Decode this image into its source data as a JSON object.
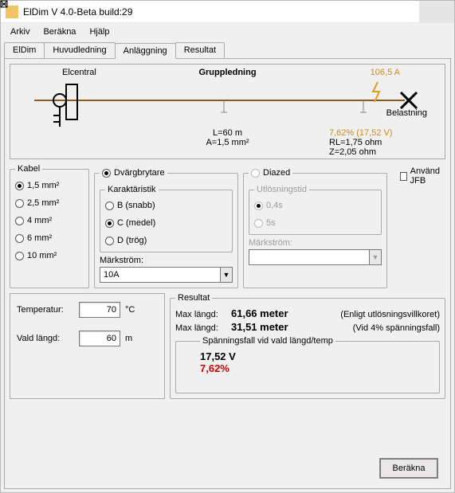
{
  "title": "ElDim V 4.0-Beta build:29",
  "menu": {
    "arkiv": "Arkiv",
    "berakna": "Beräkna",
    "hjalp": "Hjälp"
  },
  "tabs": {
    "eldim": "ElDim",
    "huvud": "Huvudledning",
    "anlagg": "Anläggning",
    "resultat": "Resultat"
  },
  "diagram": {
    "elcentral": "Elcentral",
    "gruppledning": "Gruppledning",
    "current": "106,5 A",
    "belastning": "Belastning",
    "len": "L=60 m",
    "area": "A=1,5 mm²",
    "pct": "7,62% (17,52 V)",
    "rl": "RL=1,75 ohm",
    "z": "Z=2,05 ohm"
  },
  "kabel": {
    "legend": "Kabel",
    "o1": "1,5 mm²",
    "o2": "2,5 mm²",
    "o3": "4 mm²",
    "o4": "6 mm²",
    "o5": "10 mm²"
  },
  "dvarg": {
    "legend": "Dvärgbrytare",
    "karlegend": "Karaktäristik",
    "b": "B  (snabb)",
    "c": "C  (medel)",
    "d": "D  (trög)",
    "marklabel": "Märkström:",
    "markval": "10A"
  },
  "diazed": {
    "legend": "Diazed",
    "utllegend": "Utlösningstid",
    "t04": "0,4s",
    "t5": "5s",
    "marklabel": "Märkström:",
    "markval": ""
  },
  "jfb": {
    "label": "Använd JFB"
  },
  "settings": {
    "temp_label": "Temperatur:",
    "temp_val": "70",
    "temp_unit": "°C",
    "len_label": "Vald längd:",
    "len_val": "60",
    "len_unit": "m"
  },
  "result": {
    "legend": "Resultat",
    "max1_label": "Max längd:",
    "max1_val": "61,66 meter",
    "max1_note": "(Enligt utlösningsvillkoret)",
    "max2_label": "Max längd:",
    "max2_val": "31,51 meter",
    "max2_note": "(Vid 4% spänningsfall)",
    "drop_legend": "Spänningsfall vid vald längd/temp",
    "drop_v": "17,52 V",
    "drop_pct": "7,62%"
  },
  "footer": {
    "calc": "Beräkna"
  }
}
